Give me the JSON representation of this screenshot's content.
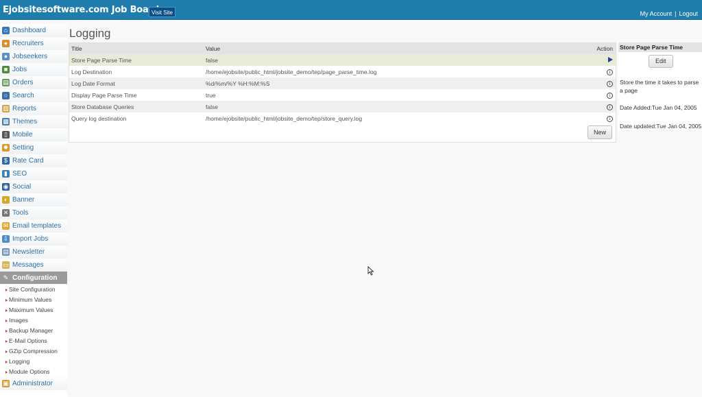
{
  "header": {
    "brand": "Ejobsitesoftware.com Job Board",
    "visit_site": "Visit Site",
    "my_account": "My Account",
    "separator": "|",
    "logout": "Logout"
  },
  "sidebar": {
    "items": [
      {
        "label": "Dashboard",
        "icon": "home-icon",
        "color": "#3a78b5"
      },
      {
        "label": "Recruiters",
        "icon": "user-icon",
        "color": "#d98e2b"
      },
      {
        "label": "Jobseekers",
        "icon": "users-icon",
        "color": "#5a8fc4"
      },
      {
        "label": "Jobs",
        "icon": "briefcase-icon",
        "color": "#4e8d3a"
      },
      {
        "label": "Orders",
        "icon": "cart-icon",
        "color": "#6a9a5a"
      },
      {
        "label": "Search",
        "icon": "search-icon",
        "color": "#3d6fa3"
      },
      {
        "label": "Reports",
        "icon": "book-icon",
        "color": "#d4a347"
      },
      {
        "label": "Themes",
        "icon": "grid-icon",
        "color": "#4b7fa8"
      },
      {
        "label": "Mobile",
        "icon": "mobile-icon",
        "color": "#555555"
      },
      {
        "label": "Setting",
        "icon": "gear-icon",
        "color": "#d89a2d"
      },
      {
        "label": "Rate Card",
        "icon": "dollar-icon",
        "color": "#2f6aa3"
      },
      {
        "label": "SEO",
        "icon": "bar-chart-icon",
        "color": "#3d7fb3"
      },
      {
        "label": "Social",
        "icon": "globe-icon",
        "color": "#2c5f96"
      },
      {
        "label": "Banner",
        "icon": "palette-icon",
        "color": "#d4a82a"
      },
      {
        "label": "Tools",
        "icon": "tools-icon",
        "color": "#777777"
      },
      {
        "label": "Email templates",
        "icon": "mail-icon",
        "color": "#e3a634"
      },
      {
        "label": "Import Jobs",
        "icon": "import-icon",
        "color": "#4a8ec7"
      },
      {
        "label": "Newsletter",
        "icon": "newsletter-icon",
        "color": "#6b8fb5"
      },
      {
        "label": "Messages",
        "icon": "message-icon",
        "color": "#d8b45a"
      },
      {
        "label": "Configuration",
        "icon": "config-icon",
        "color": "#f0f0f0",
        "active": true
      }
    ],
    "subitems": [
      "Site Configuration",
      "Minimum Values",
      "Maximum Values",
      "Images",
      "Backup Manager",
      "E-Mail Options",
      "GZip Compression",
      "Logging",
      "Module Options"
    ],
    "bottom_items": [
      {
        "label": "Administrator",
        "icon": "lock-icon",
        "color": "#d89a2d"
      }
    ]
  },
  "main": {
    "title": "Logging",
    "table": {
      "columns": [
        "Title",
        "Value",
        "Action"
      ],
      "rows": [
        {
          "title": "Store Page Parse Time",
          "value": "false",
          "action": "play-icon",
          "selected": true
        },
        {
          "title": "Log Destination",
          "value": "/home/ejobsite/public_html/jobsite_demo/tep/page_parse_time.log",
          "action": "info-icon"
        },
        {
          "title": "Log Date Format",
          "value": "%d/%m/%Y %H:%M:%S",
          "action": "info-icon"
        },
        {
          "title": "Display Page Parse Time",
          "value": "true",
          "action": "info-icon"
        },
        {
          "title": "Store Database Queries",
          "value": "false",
          "action": "info-icon"
        },
        {
          "title": "Query log destination",
          "value": "/home/ejobsite/public_html/jobsite_demo/tep/store_query.log",
          "action": "info-icon"
        }
      ]
    },
    "new_button": "New"
  },
  "detail": {
    "title": "Store Page Parse Time",
    "edit_button": "Edit",
    "description": "Store the time it takes to parse a page",
    "date_added": "Date Added:Tue Jan 04, 2005",
    "date_updated": "Date updated:Tue Jan 04, 2005"
  }
}
